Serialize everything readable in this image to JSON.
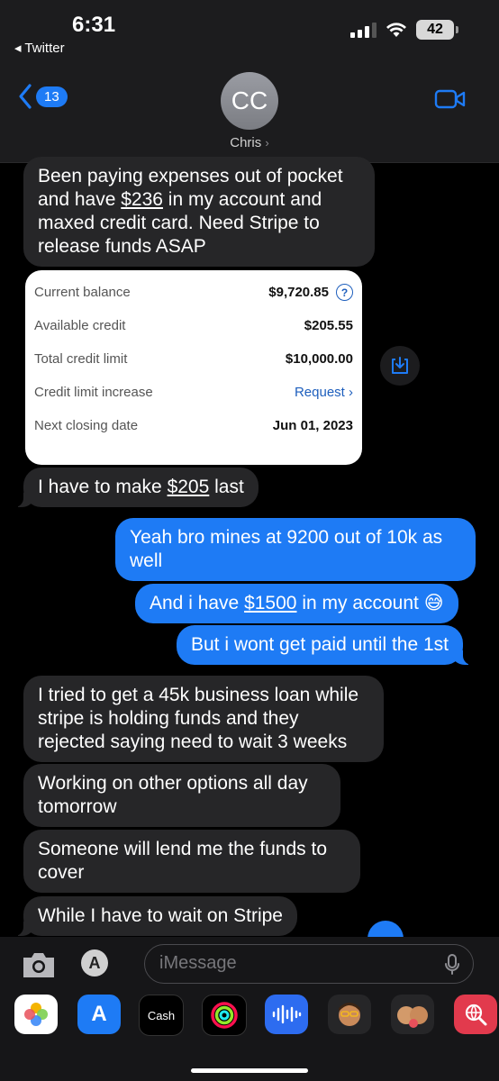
{
  "status": {
    "time": "6:31",
    "back_app": "◂ Twitter",
    "battery": "42"
  },
  "header": {
    "back_count": "13",
    "avatar_initials": "CC",
    "contact_name": "Chris",
    "chevron": "›"
  },
  "messages": [
    {
      "from": "them",
      "parts": [
        "Been paying expenses out of pocket and have ",
        "$236",
        " in my account and maxed credit card. Need Stripe to release funds ASAP"
      ]
    },
    {
      "from": "them",
      "parts": [
        "I have to make ",
        "$205",
        " last"
      ]
    },
    {
      "from": "me",
      "text": "Yeah bro mines at 9200 out of 10k as well"
    },
    {
      "from": "me",
      "parts": [
        "And i have ",
        "$1500",
        " in my account 😅"
      ]
    },
    {
      "from": "me",
      "text": "But i wont get paid until the 1st"
    },
    {
      "from": "them",
      "text": "I tried to get a 45k business loan while stripe is holding funds and they rejected saying need to wait 3 weeks"
    },
    {
      "from": "them",
      "text": "Working on other options all day tomorrow"
    },
    {
      "from": "them",
      "text": "Someone will lend me the funds to cover"
    },
    {
      "from": "them",
      "text": "While I have to wait on Stripe"
    }
  ],
  "card": {
    "rows": [
      {
        "label": "Current balance",
        "value": "$9,720.85"
      },
      {
        "label": "Available credit",
        "value": "$205.55"
      },
      {
        "label": "Total credit limit",
        "value": "$10,000.00"
      },
      {
        "label": "Credit limit increase",
        "value": "Request ›"
      },
      {
        "label": "Next closing date",
        "value": "Jun 01, 2023"
      }
    ]
  },
  "compose": {
    "placeholder": "iMessage"
  },
  "tray": {
    "cash_label": "Cash"
  },
  "colors": {
    "sent": "#1e7bf5",
    "received": "#262628",
    "background": "#000000"
  }
}
